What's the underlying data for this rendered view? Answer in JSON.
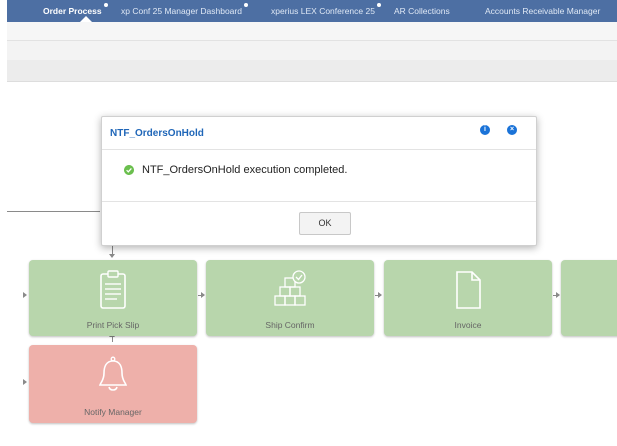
{
  "nav": {
    "tabs": [
      {
        "label": "Order Process",
        "active": true,
        "dot": true
      },
      {
        "label": "xp Conf 25 Manager Dashboard",
        "active": false,
        "dot": true
      },
      {
        "label": "xperius LEX Conference 25",
        "active": false,
        "dot": true
      },
      {
        "label": "AR Collections",
        "active": false,
        "dot": false
      },
      {
        "label": "Accounts Receivable Manager",
        "active": false,
        "dot": false
      }
    ],
    "background_color": "#4d6fa3"
  },
  "dialog": {
    "title": "NTF_OrdersOnHold",
    "message": "NTF_OrdersOnHold execution completed.",
    "ok_label": "OK",
    "info_icon": "info-icon",
    "close_icon": "close-icon",
    "status_icon": "check-circle-icon",
    "status_color": "#6bbf4e"
  },
  "process": {
    "nodes": [
      {
        "label": "Print Pick Slip",
        "icon": "clipboard-list-icon",
        "status": "green"
      },
      {
        "label": "Ship Confirm",
        "icon": "boxes-check-icon",
        "status": "green"
      },
      {
        "label": "Invoice",
        "icon": "document-icon",
        "status": "green"
      },
      {
        "label": "",
        "icon": "",
        "status": "green"
      },
      {
        "label": "Notify Manager",
        "icon": "bell-icon",
        "status": "red"
      }
    ],
    "colors": {
      "green": "#b8d6ac",
      "red": "#eeb0aa"
    }
  }
}
